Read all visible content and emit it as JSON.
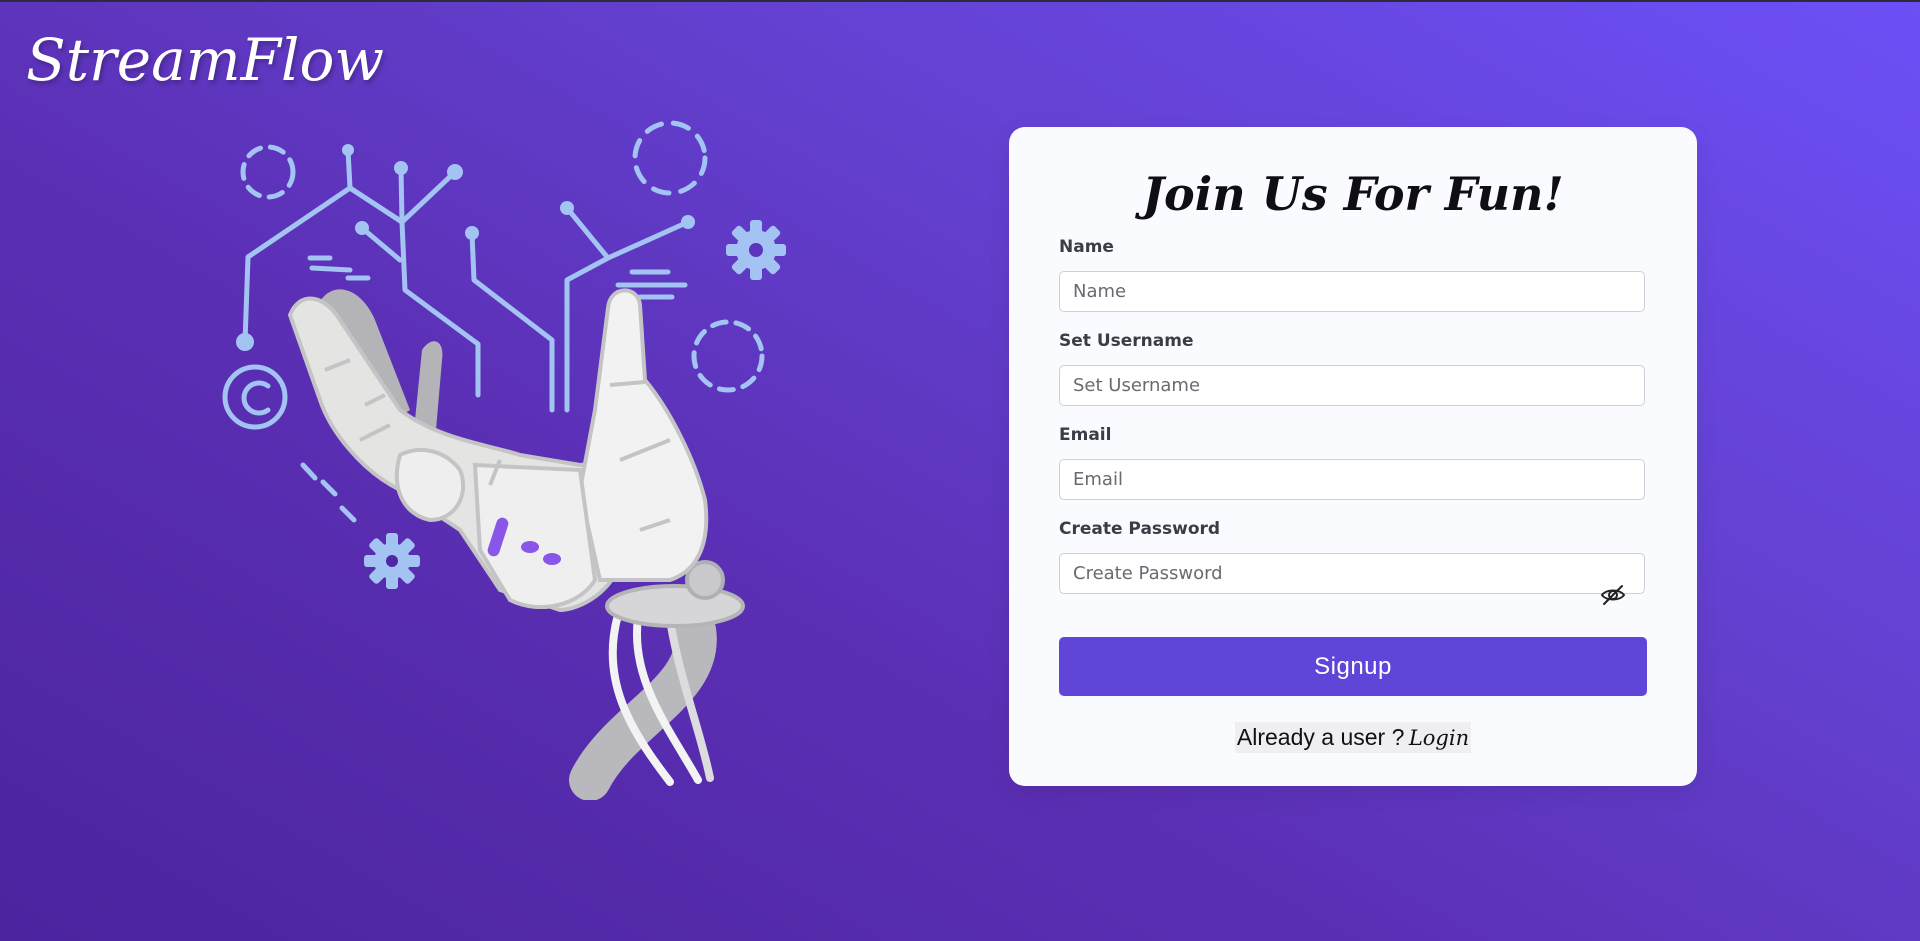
{
  "app": {
    "brand": "StreamFlow"
  },
  "form": {
    "title": "Join Us For Fun!",
    "fields": {
      "name": {
        "label": "Name",
        "placeholder": "Name",
        "value": ""
      },
      "username": {
        "label": "Set Username",
        "placeholder": "Set Username",
        "value": ""
      },
      "email": {
        "label": "Email",
        "placeholder": "Email",
        "value": ""
      },
      "password": {
        "label": "Create Password",
        "placeholder": "Create Password",
        "value": ""
      }
    },
    "password_toggle_icon": "eye-slash-icon",
    "submit_label": "Signup",
    "footer": {
      "prompt": "Already a user ?",
      "link_label": "Login"
    }
  },
  "illustration": {
    "subject": "robot-hand-icon"
  },
  "colors": {
    "background_start": "#4b24a0",
    "background_end": "#6d4ff7",
    "primary_button": "#6145d8",
    "card_background": "#fafbfe",
    "illustration_accent": "#a3c4f3"
  }
}
